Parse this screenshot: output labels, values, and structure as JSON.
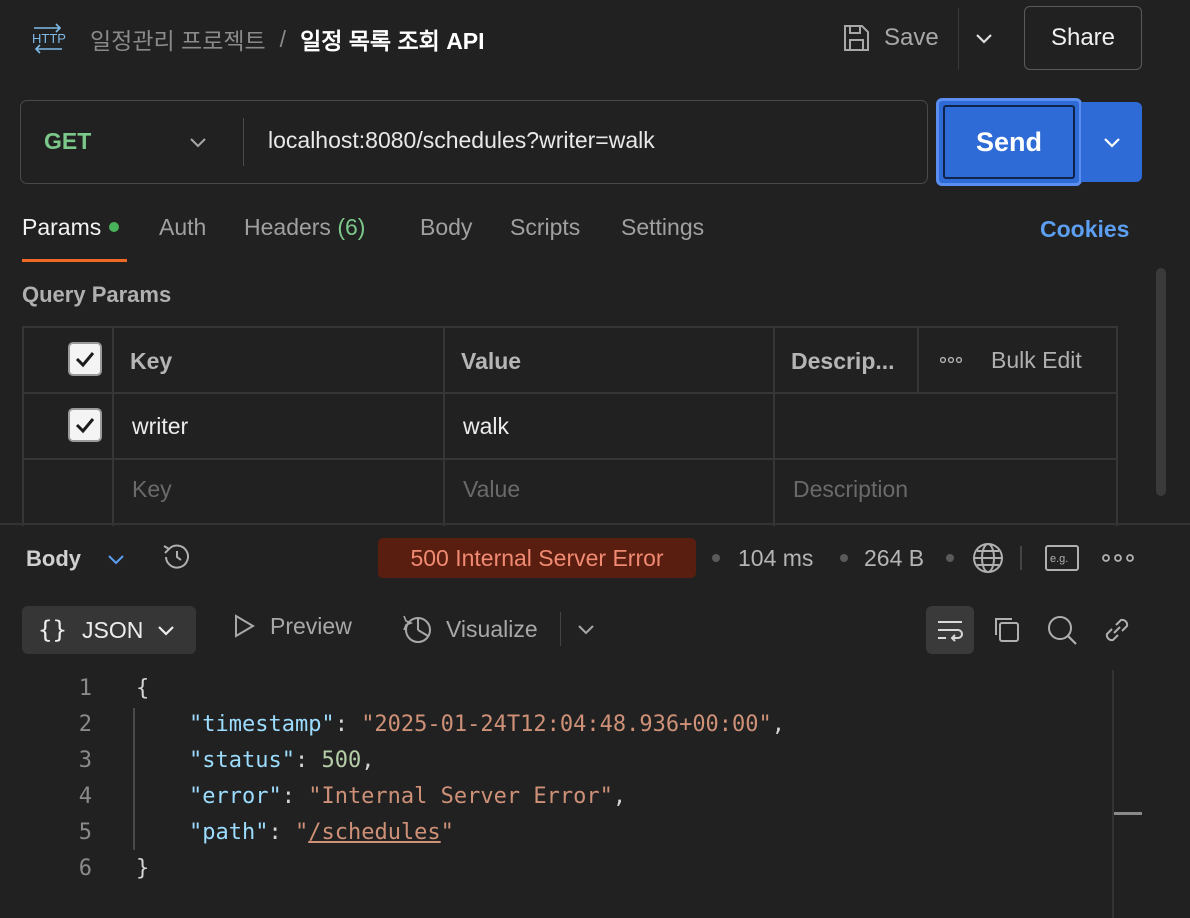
{
  "header": {
    "app_icon": "http-icon",
    "project": "일정관리 프로젝트",
    "separator": "/",
    "request_name": "일정 목록 조회 API",
    "save_label": "Save",
    "share_label": "Share"
  },
  "request": {
    "method": "GET",
    "url": "localhost:8080/schedules?writer=walk",
    "send_label": "Send"
  },
  "tabs": {
    "params": "Params",
    "auth": "Auth",
    "headers": "Headers",
    "headers_count": "(6)",
    "body": "Body",
    "scripts": "Scripts",
    "settings": "Settings",
    "cookies": "Cookies"
  },
  "query_params": {
    "title": "Query Params",
    "columns": {
      "key": "Key",
      "value": "Value",
      "description": "Descrip...",
      "bulk_edit": "Bulk Edit"
    },
    "rows": [
      {
        "checked": true,
        "key": "writer",
        "value": "walk",
        "description": ""
      }
    ],
    "placeholders": {
      "key": "Key",
      "value": "Value",
      "description": "Description"
    }
  },
  "response": {
    "body_label": "Body",
    "status": "500 Internal Server Error",
    "time": "104 ms",
    "size": "264 B",
    "format": "JSON",
    "preview_label": "Preview",
    "visualize_label": "Visualize",
    "status_color": "#5a1e10"
  },
  "code": {
    "line_numbers": [
      "1",
      "2",
      "3",
      "4",
      "5",
      "6"
    ],
    "open_brace": "{",
    "close_brace": "}",
    "fields": [
      {
        "key": "\"timestamp\"",
        "value": "\"2025-01-24T12:04:48.936+00:00\"",
        "trail": ","
      },
      {
        "key": "\"status\"",
        "value": "500",
        "trail": ","
      },
      {
        "key": "\"error\"",
        "value": "\"Internal Server Error\"",
        "trail": ","
      },
      {
        "key": "\"path\"",
        "value_q1": "\"",
        "value_link": "/schedules",
        "value_q2": "\"",
        "trail": ""
      }
    ]
  },
  "colors": {
    "accent_send": "#2f6bd6",
    "tab_indicator": "#f06a26",
    "cookies_link": "#5c9ef0",
    "method_get": "#7cc88b"
  }
}
